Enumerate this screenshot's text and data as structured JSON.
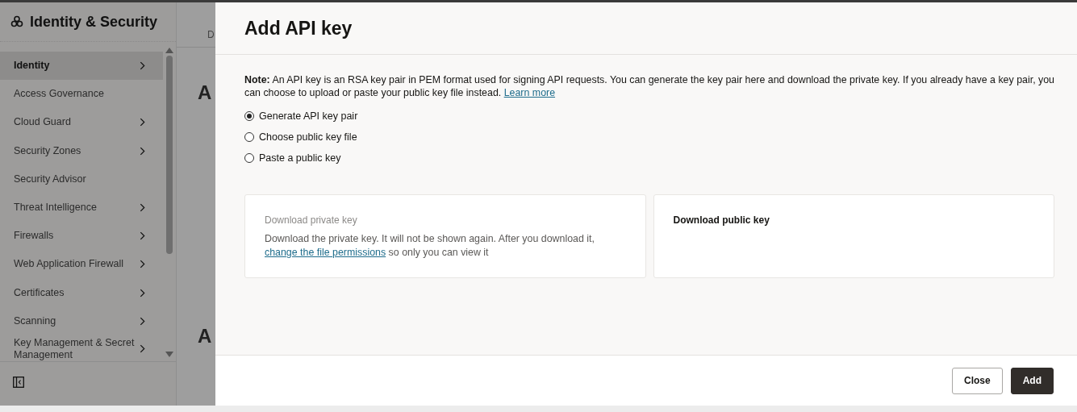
{
  "sidebar": {
    "title": "Identity & Security",
    "items": [
      {
        "label": "Identity",
        "has_submenu": true,
        "selected": true
      },
      {
        "label": "Access Governance",
        "has_submenu": false,
        "selected": false
      },
      {
        "label": "Cloud Guard",
        "has_submenu": true,
        "selected": false
      },
      {
        "label": "Security Zones",
        "has_submenu": true,
        "selected": false
      },
      {
        "label": "Security Advisor",
        "has_submenu": false,
        "selected": false
      },
      {
        "label": "Threat Intelligence",
        "has_submenu": true,
        "selected": false
      },
      {
        "label": "Firewalls",
        "has_submenu": true,
        "selected": false
      },
      {
        "label": "Web Application Firewall",
        "has_submenu": true,
        "selected": false
      },
      {
        "label": "Certificates",
        "has_submenu": true,
        "selected": false
      },
      {
        "label": "Scanning",
        "has_submenu": true,
        "selected": false
      },
      {
        "label": "Key Management & Secret Management",
        "has_submenu": true,
        "selected": false
      }
    ]
  },
  "background_page": {
    "tab": "D",
    "headings": [
      "A",
      "A"
    ]
  },
  "dialog": {
    "title": "Add API key",
    "note": {
      "label": "Note:",
      "text": "An API key is an RSA key pair in PEM format used for signing API requests. You can generate the key pair here and download the private key. If you already have a key pair, you can choose to upload or paste your public key file instead.",
      "link": "Learn more"
    },
    "options": [
      {
        "label": "Generate API key pair",
        "selected": true
      },
      {
        "label": "Choose public key file",
        "selected": false
      },
      {
        "label": "Paste a public key",
        "selected": false
      }
    ],
    "cards": [
      {
        "title": "Download private key",
        "disabled": true,
        "text_before": "Download the private key. It will not be shown again. After you download it,",
        "link": "change the file permissions",
        "text_after": "so only you can view it"
      },
      {
        "title": "Download public key",
        "disabled": false
      }
    ],
    "buttons": [
      {
        "label": "Close",
        "kind": "secondary"
      },
      {
        "label": "Add",
        "kind": "primary"
      }
    ]
  }
}
